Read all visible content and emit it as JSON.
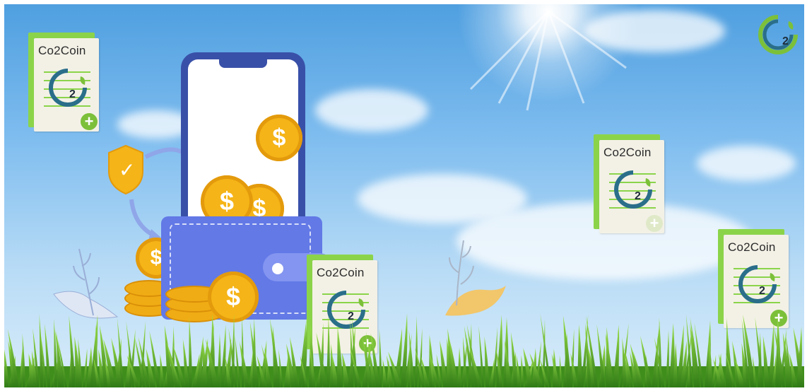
{
  "cards": [
    {
      "id": "card-top-left",
      "title": "Co2Coin"
    },
    {
      "id": "card-center",
      "title": "Co2Coin"
    },
    {
      "id": "card-right-upper",
      "title": "Co2Coin"
    },
    {
      "id": "card-right-lower",
      "title": "Co2Coin"
    }
  ],
  "logo": {
    "glyph": "2"
  },
  "coin_symbol": "$",
  "shield_glyph": "✓",
  "colors": {
    "brand_green": "#7cc03a",
    "coin_gold": "#f5b417",
    "wallet_blue": "#6279e6",
    "phone_blue": "#3950a8",
    "logo_teal": "#2a6e8a"
  }
}
